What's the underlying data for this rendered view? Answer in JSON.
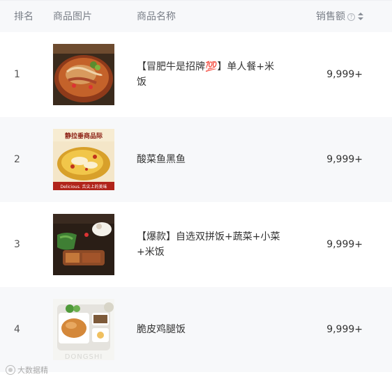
{
  "header": {
    "rank": "排名",
    "image": "商品图片",
    "name": "商品名称",
    "sales": "销售额",
    "help_glyph": "?"
  },
  "rows": [
    {
      "rank": "1",
      "name": "【冒肥牛是招牌💯】单人餐+米饭",
      "sales": "9,999+",
      "image_desc": "beef-noodle-bowl"
    },
    {
      "rank": "2",
      "name": "酸菜鱼黑鱼",
      "sales": "9,999+",
      "image_desc": "pickled-fish",
      "image_caption_top": "静拉垂商品际",
      "image_caption_bottom": "Delicious. 舌尖上的美味"
    },
    {
      "rank": "3",
      "name": "【爆款】自选双拼饭+蔬菜+小菜+米饭",
      "sales": "9,999+",
      "image_desc": "double-combo-rice"
    },
    {
      "rank": "4",
      "name": "脆皮鸡腿饭",
      "sales": "9,999+",
      "image_desc": "crispy-chicken-rice",
      "image_caption": "DONGSHI"
    }
  ],
  "watermark": "大数据精",
  "colors": {
    "header_bg": "#f7f8fa",
    "alt_row_bg": "#f7f8fa",
    "text": "#333333",
    "muted": "#7a7f88"
  }
}
